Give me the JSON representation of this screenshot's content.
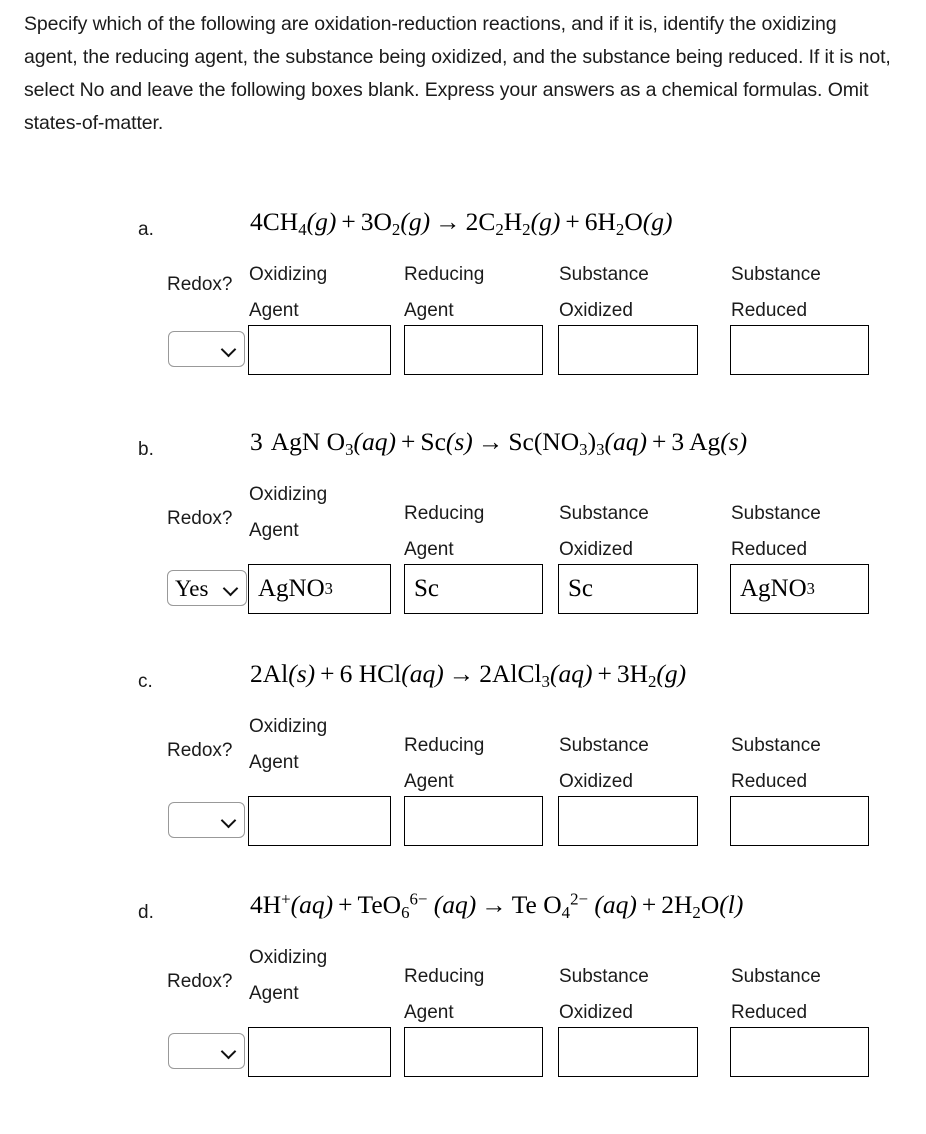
{
  "prompt": "Specify which of the following are oxidation-reduction reactions, and if it is, identify the oxidizing agent, the reducing agent, the substance being oxidized, and the substance being reduced. If it is not, select No and leave the following boxes blank. Express your answers as a chemical formulas. Omit states-of-matter.",
  "headers": {
    "redox": "Redox?",
    "oxidizing_agent_l1": "Oxidizing",
    "oxidizing_agent_l2": "Agent",
    "reducing_agent_l1": "Reducing",
    "reducing_agent_l2": "Agent",
    "substance_oxidized_l1": "Substance",
    "substance_oxidized_l2": "Oxidized",
    "substance_reduced_l1": "Substance",
    "substance_reduced_l2": "Reduced"
  },
  "problems": [
    {
      "label": "a.",
      "equation_plain": "4CH4(g) + 3O2(g) → 2C2H2(g) + 6H2O(g)",
      "redox_value": "",
      "oxidizing_agent": "",
      "reducing_agent": "",
      "substance_oxidized": "",
      "substance_reduced": ""
    },
    {
      "label": "b.",
      "equation_plain": "3 AgN O3(aq) + Sc(s) → Sc(NO3)3(aq) + 3 Ag(s)",
      "redox_value": "Yes",
      "oxidizing_agent": "AgNO3",
      "reducing_agent": "Sc",
      "substance_oxidized": "Sc",
      "substance_reduced": "AgNO3"
    },
    {
      "label": "c.",
      "equation_plain": "2Al(s) + 6 HCl(aq) → 2AlCl3(aq) + 3H2(g)",
      "redox_value": "",
      "oxidizing_agent": "",
      "reducing_agent": "",
      "substance_oxidized": "",
      "substance_reduced": ""
    },
    {
      "label": "d.",
      "equation_plain": "4H+(aq) + TeO6 6-(aq) → Te O4 2-(aq) + 2H2O(l)",
      "redox_value": "",
      "oxidizing_agent": "",
      "reducing_agent": "",
      "substance_oxidized": "",
      "substance_reduced": ""
    }
  ],
  "icons": {
    "dropdown": "chevron-down-icon"
  }
}
